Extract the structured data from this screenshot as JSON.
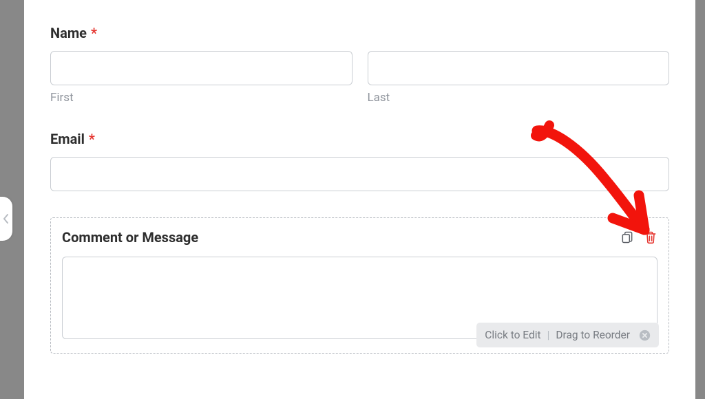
{
  "name_field": {
    "label": "Name",
    "required_mark": "*",
    "first_sub": "First",
    "last_sub": "Last"
  },
  "email_field": {
    "label": "Email",
    "required_mark": "*"
  },
  "comment_field": {
    "label": "Comment or Message",
    "actions": {
      "duplicate_icon": "duplicate-icon",
      "delete_icon": "trash-icon"
    }
  },
  "hint": {
    "click_text": "Click to Edit",
    "drag_text": "Drag to Reorder"
  }
}
